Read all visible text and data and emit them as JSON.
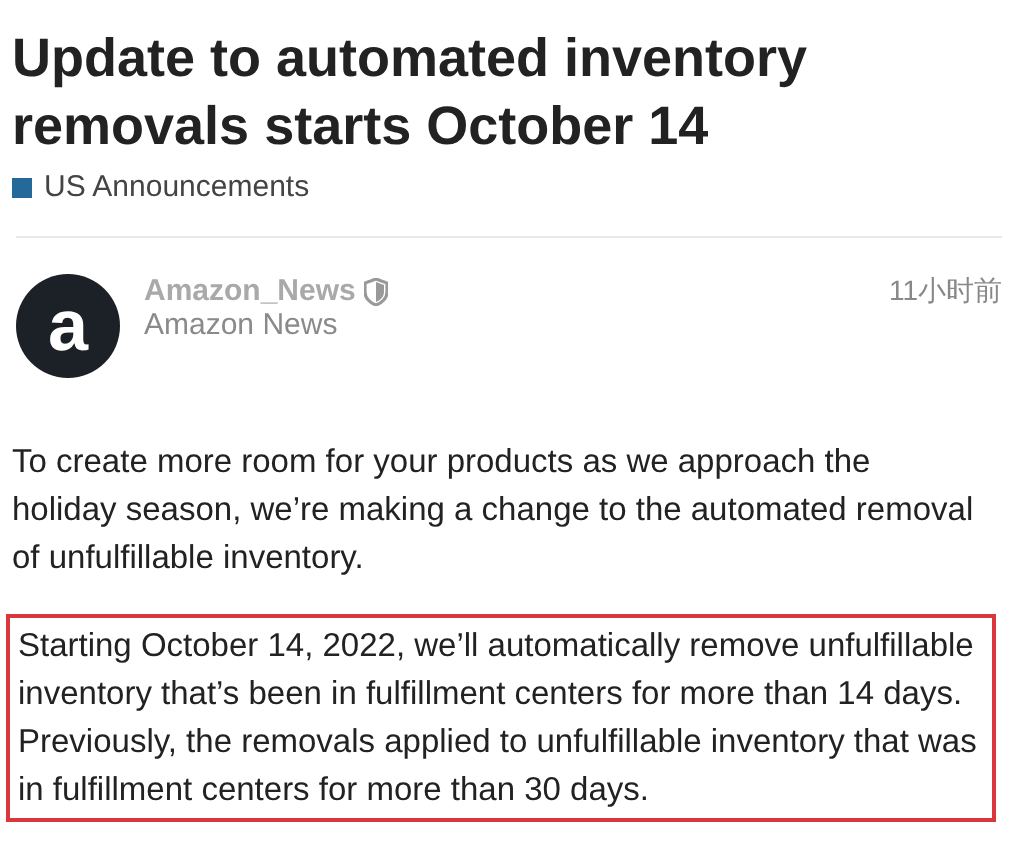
{
  "post": {
    "title": "Update to automated inventory removals starts October 14",
    "category": "US Announcements",
    "author": {
      "avatar_letter": "a",
      "username": "Amazon_News",
      "display_name": "Amazon News",
      "time": "11小时前"
    },
    "paragraphs": [
      {
        "text": "To create more room for your products as we approach the holiday season, we’re making a change to the automated removal of unfulfillable inventory.",
        "highlighted": false
      },
      {
        "text": "Starting October 14, 2022, we’ll automatically remove unfulfillable inventory that’s been in fulfillment centers for more than 14 days. Previously, the removals applied to unfulfillable inventory that was in fulfillment centers for more than 30 days.",
        "highlighted": true
      }
    ]
  }
}
